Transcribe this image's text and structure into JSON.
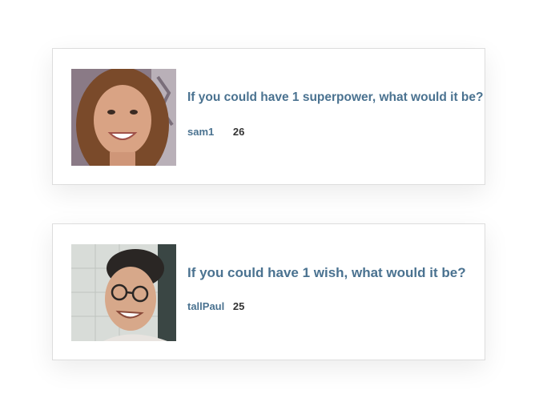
{
  "posts": [
    {
      "avatar_alt": "sam1 avatar",
      "question": "If you could have 1 superpower, what would it be?",
      "username": "sam1",
      "score": "26"
    },
    {
      "avatar_alt": "tallPaul avatar",
      "question": "If you could have 1 wish, what would it be?",
      "username": "tallPaul",
      "score": "25"
    }
  ],
  "colors": {
    "accent": "#4a7290",
    "score": "#333333",
    "card_border": "#dddddd"
  }
}
